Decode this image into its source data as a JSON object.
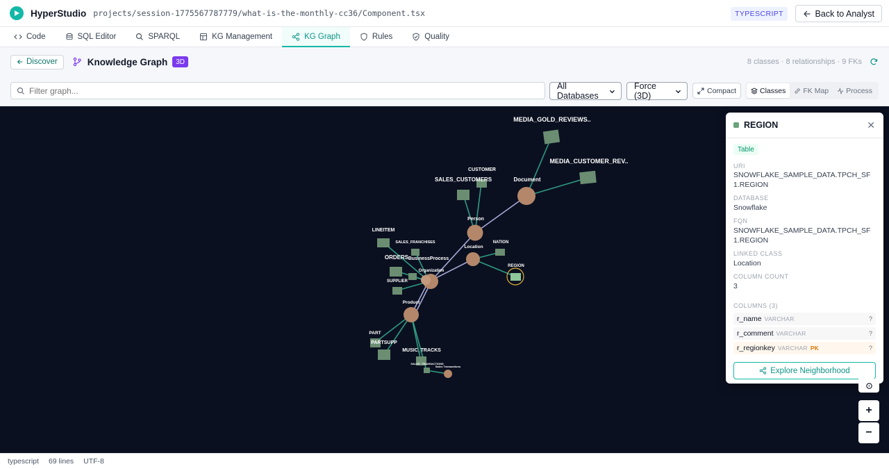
{
  "app": {
    "name": "HyperStudio",
    "file_path": "projects/session-1775567787779/what-is-the-monthly-cc36/Component.tsx",
    "language_badge": "TYPESCRIPT",
    "back_label": "Back to Analyst"
  },
  "tabs": [
    {
      "label": "Code",
      "icon": "code-icon"
    },
    {
      "label": "SQL Editor",
      "icon": "database-icon"
    },
    {
      "label": "SPARQL",
      "icon": "search-icon"
    },
    {
      "label": "KG Management",
      "icon": "table-icon"
    },
    {
      "label": "KG Graph",
      "icon": "share-icon",
      "active": true
    },
    {
      "label": "Rules",
      "icon": "shield-icon"
    },
    {
      "label": "Quality",
      "icon": "shield-check-icon"
    }
  ],
  "subheader": {
    "discover_label": "Discover",
    "title": "Knowledge Graph",
    "badge": "3D",
    "stats": "8 classes · 8 relationships · 9 FKs"
  },
  "filters": {
    "search_placeholder": "Filter graph...",
    "database_value": "All Databases",
    "layout_value": "Force (3D)",
    "compact_label": "Compact",
    "views": [
      "Classes",
      "FK Map",
      "Process"
    ],
    "active_view": "Classes"
  },
  "graph": {
    "background": "#0b1020",
    "class_color": "#b4876a",
    "table_color": "#6b8e72",
    "edge_class_color": "#a7a9d6",
    "edge_table_color": "#2f9b82",
    "selected_node": "REGION",
    "class_labels": [
      "Document",
      "Person",
      "Location",
      "BusinessProcess",
      "Organization",
      "Product",
      "Sales Transactions"
    ],
    "table_labels": [
      "MEDIA_GOLD_REVIEWS..",
      "MEDIA_CUSTOMER_REV..",
      "CUSTOMER",
      "SALES_CUSTOMERS",
      "LINEITEM",
      "SALES_FRANCHISES",
      "NATION",
      "ORDERS",
      "REGION",
      "SUPPLIER",
      "PART",
      "PARTSUPP",
      "MUSIC_TRACKS",
      "SALES_TRANSACTIONS"
    ]
  },
  "panel": {
    "title": "REGION",
    "type": "Table",
    "uri_label": "URI",
    "uri": "SNOWFLAKE_SAMPLE_DATA.TPCH_SF1.REGION",
    "database_label": "DATABASE",
    "database": "Snowflake",
    "fqn_label": "FQN",
    "fqn": "SNOWFLAKE_SAMPLE_DATA.TPCH_SF1.REGION",
    "linked_class_label": "LINKED CLASS",
    "linked_class": "Location",
    "column_count_label": "COLUMN COUNT",
    "column_count": "3",
    "columns_header": "COLUMNS (3)",
    "columns": [
      {
        "name": "r_name",
        "type": "VARCHAR",
        "pk": ""
      },
      {
        "name": "r_comment",
        "type": "VARCHAR",
        "pk": ""
      },
      {
        "name": "r_regionkey",
        "type": "VARCHAR",
        "pk": "PK"
      }
    ],
    "explore_label": "Explore Neighborhood"
  },
  "zoom": {
    "in": "+",
    "out": "−"
  },
  "status": {
    "language": "typescript",
    "lines": "69 lines",
    "encoding": "UTF-8"
  }
}
